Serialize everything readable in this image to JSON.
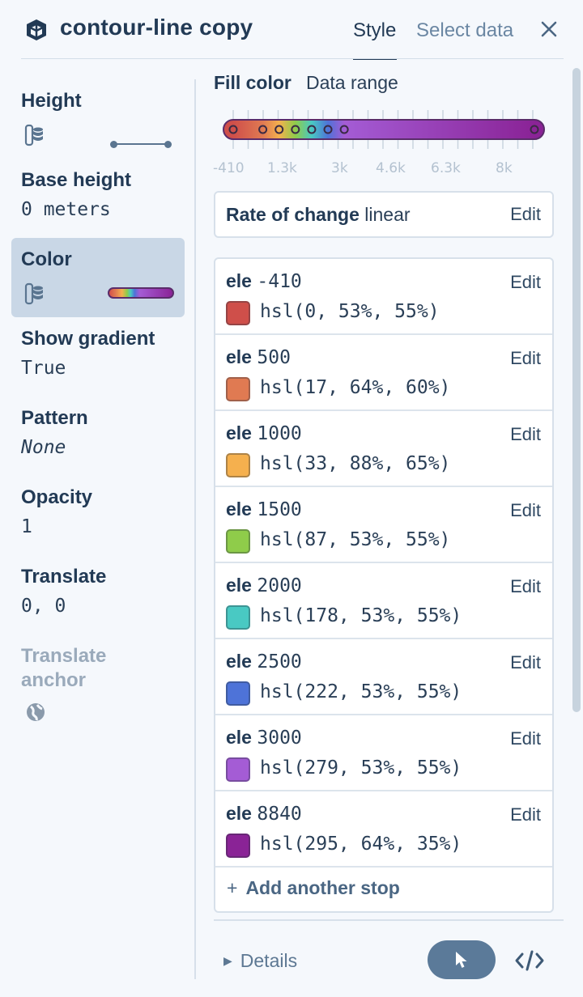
{
  "header": {
    "title": "contour-line copy",
    "tabs": [
      {
        "label": "Style",
        "active": true
      },
      {
        "label": "Select data",
        "active": false
      }
    ],
    "close_icon": "close-icon",
    "layer_icon": "layer-cube-icon"
  },
  "sidebar": {
    "items": [
      {
        "label": "Height",
        "value": "",
        "icon": "database-icon"
      },
      {
        "label": "Base height",
        "value": "0 meters"
      },
      {
        "label": "Color",
        "value": "",
        "icon": "database-icon",
        "selected": true
      },
      {
        "label": "Show gradient",
        "value": "True"
      },
      {
        "label": "Pattern",
        "value": "None"
      },
      {
        "label": "Opacity",
        "value": "1"
      },
      {
        "label": "Translate",
        "value": "0, 0"
      },
      {
        "label": "Translate anchor",
        "value": "",
        "icon": "globe-icon",
        "disabled": true
      }
    ]
  },
  "fill": {
    "label": "Fill color",
    "sublabel": "Data range",
    "ticks": [
      "-410",
      "1.3k",
      "3k",
      "4.6k",
      "6.3k",
      "8k"
    ],
    "range_min": -410,
    "range_max": 8840
  },
  "rate": {
    "label": "Rate of change",
    "value": "linear",
    "edit": "Edit"
  },
  "stops": [
    {
      "prop": "ele",
      "value": "-410",
      "color_text": "hsl(0, 53%, 55%)",
      "color": "#cf4f4a"
    },
    {
      "prop": "ele",
      "value": "500",
      "color_text": "hsl(17, 64%, 60%)",
      "color": "#e07a52"
    },
    {
      "prop": "ele",
      "value": "1000",
      "color_text": "hsl(33, 88%, 65%)",
      "color": "#f5b04e"
    },
    {
      "prop": "ele",
      "value": "1500",
      "color_text": "hsl(87, 53%, 55%)",
      "color": "#8fcc4a"
    },
    {
      "prop": "ele",
      "value": "2000",
      "color_text": "hsl(178, 53%, 55%)",
      "color": "#49c9c3"
    },
    {
      "prop": "ele",
      "value": "2500",
      "color_text": "hsl(222, 53%, 55%)",
      "color": "#4e73d8"
    },
    {
      "prop": "ele",
      "value": "3000",
      "color_text": "hsl(279, 53%, 55%)",
      "color": "#a45cd5"
    },
    {
      "prop": "ele",
      "value": "8840",
      "color_text": "hsl(295, 64%, 35%)",
      "color": "#8a2396"
    }
  ],
  "edit_label": "Edit",
  "add_stop": "Add another stop",
  "footer": {
    "details": "Details",
    "pointer_icon": "pointer-icon",
    "code_icon": "code-icon"
  }
}
